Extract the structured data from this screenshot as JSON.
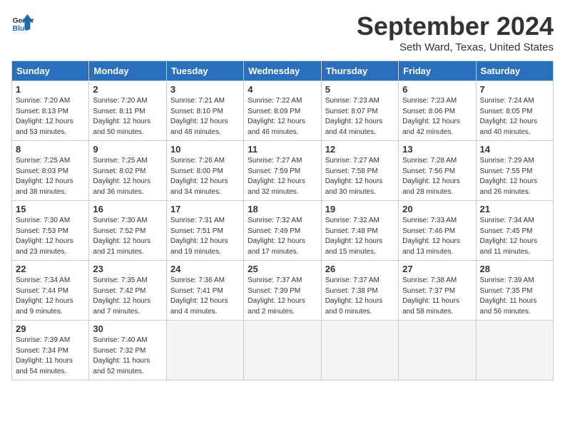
{
  "header": {
    "logo_line1": "General",
    "logo_line2": "Blue",
    "month": "September 2024",
    "location": "Seth Ward, Texas, United States"
  },
  "days_of_week": [
    "Sunday",
    "Monday",
    "Tuesday",
    "Wednesday",
    "Thursday",
    "Friday",
    "Saturday"
  ],
  "weeks": [
    [
      {
        "day": 1,
        "sunrise": "7:20 AM",
        "sunset": "8:13 PM",
        "daylight": "12 hours and 53 minutes."
      },
      {
        "day": 2,
        "sunrise": "7:20 AM",
        "sunset": "8:11 PM",
        "daylight": "12 hours and 50 minutes."
      },
      {
        "day": 3,
        "sunrise": "7:21 AM",
        "sunset": "8:10 PM",
        "daylight": "12 hours and 48 minutes."
      },
      {
        "day": 4,
        "sunrise": "7:22 AM",
        "sunset": "8:09 PM",
        "daylight": "12 hours and 46 minutes."
      },
      {
        "day": 5,
        "sunrise": "7:23 AM",
        "sunset": "8:07 PM",
        "daylight": "12 hours and 44 minutes."
      },
      {
        "day": 6,
        "sunrise": "7:23 AM",
        "sunset": "8:06 PM",
        "daylight": "12 hours and 42 minutes."
      },
      {
        "day": 7,
        "sunrise": "7:24 AM",
        "sunset": "8:05 PM",
        "daylight": "12 hours and 40 minutes."
      }
    ],
    [
      {
        "day": 8,
        "sunrise": "7:25 AM",
        "sunset": "8:03 PM",
        "daylight": "12 hours and 38 minutes."
      },
      {
        "day": 9,
        "sunrise": "7:25 AM",
        "sunset": "8:02 PM",
        "daylight": "12 hours and 36 minutes."
      },
      {
        "day": 10,
        "sunrise": "7:26 AM",
        "sunset": "8:00 PM",
        "daylight": "12 hours and 34 minutes."
      },
      {
        "day": 11,
        "sunrise": "7:27 AM",
        "sunset": "7:59 PM",
        "daylight": "12 hours and 32 minutes."
      },
      {
        "day": 12,
        "sunrise": "7:27 AM",
        "sunset": "7:58 PM",
        "daylight": "12 hours and 30 minutes."
      },
      {
        "day": 13,
        "sunrise": "7:28 AM",
        "sunset": "7:56 PM",
        "daylight": "12 hours and 28 minutes."
      },
      {
        "day": 14,
        "sunrise": "7:29 AM",
        "sunset": "7:55 PM",
        "daylight": "12 hours and 26 minutes."
      }
    ],
    [
      {
        "day": 15,
        "sunrise": "7:30 AM",
        "sunset": "7:53 PM",
        "daylight": "12 hours and 23 minutes."
      },
      {
        "day": 16,
        "sunrise": "7:30 AM",
        "sunset": "7:52 PM",
        "daylight": "12 hours and 21 minutes."
      },
      {
        "day": 17,
        "sunrise": "7:31 AM",
        "sunset": "7:51 PM",
        "daylight": "12 hours and 19 minutes."
      },
      {
        "day": 18,
        "sunrise": "7:32 AM",
        "sunset": "7:49 PM",
        "daylight": "12 hours and 17 minutes."
      },
      {
        "day": 19,
        "sunrise": "7:32 AM",
        "sunset": "7:48 PM",
        "daylight": "12 hours and 15 minutes."
      },
      {
        "day": 20,
        "sunrise": "7:33 AM",
        "sunset": "7:46 PM",
        "daylight": "12 hours and 13 minutes."
      },
      {
        "day": 21,
        "sunrise": "7:34 AM",
        "sunset": "7:45 PM",
        "daylight": "12 hours and 11 minutes."
      }
    ],
    [
      {
        "day": 22,
        "sunrise": "7:34 AM",
        "sunset": "7:44 PM",
        "daylight": "12 hours and 9 minutes."
      },
      {
        "day": 23,
        "sunrise": "7:35 AM",
        "sunset": "7:42 PM",
        "daylight": "12 hours and 7 minutes."
      },
      {
        "day": 24,
        "sunrise": "7:36 AM",
        "sunset": "7:41 PM",
        "daylight": "12 hours and 4 minutes."
      },
      {
        "day": 25,
        "sunrise": "7:37 AM",
        "sunset": "7:39 PM",
        "daylight": "12 hours and 2 minutes."
      },
      {
        "day": 26,
        "sunrise": "7:37 AM",
        "sunset": "7:38 PM",
        "daylight": "12 hours and 0 minutes."
      },
      {
        "day": 27,
        "sunrise": "7:38 AM",
        "sunset": "7:37 PM",
        "daylight": "11 hours and 58 minutes."
      },
      {
        "day": 28,
        "sunrise": "7:39 AM",
        "sunset": "7:35 PM",
        "daylight": "11 hours and 56 minutes."
      }
    ],
    [
      {
        "day": 29,
        "sunrise": "7:39 AM",
        "sunset": "7:34 PM",
        "daylight": "11 hours and 54 minutes."
      },
      {
        "day": 30,
        "sunrise": "7:40 AM",
        "sunset": "7:32 PM",
        "daylight": "11 hours and 52 minutes."
      },
      null,
      null,
      null,
      null,
      null
    ]
  ]
}
